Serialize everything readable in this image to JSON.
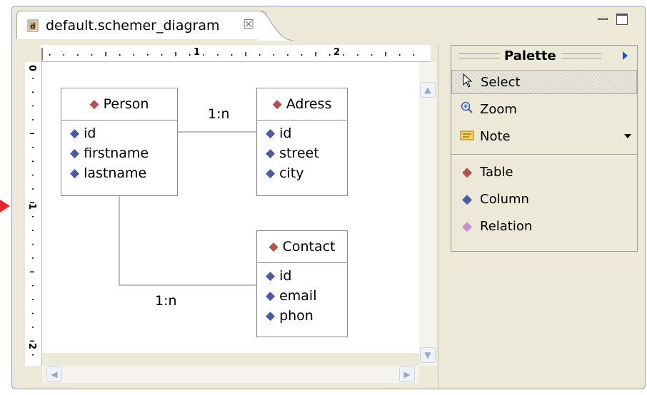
{
  "tab": {
    "title": "default.schemer_diagram",
    "close_glyph": "☒"
  },
  "ruler": {
    "top_labels": [
      "1",
      "2"
    ],
    "left_labels": [
      "0",
      "1",
      "2"
    ]
  },
  "diagram": {
    "tables": [
      {
        "name": "Person",
        "columns": [
          "id",
          "firstname",
          "lastname"
        ]
      },
      {
        "name": "Adress",
        "columns": [
          "id",
          "street",
          "city"
        ]
      },
      {
        "name": "Contact",
        "columns": [
          "id",
          "email",
          "phon"
        ]
      }
    ],
    "relations": [
      {
        "from": "Person",
        "to": "Adress",
        "label": "1:n"
      },
      {
        "from": "Person",
        "to": "Contact",
        "label": "1:n"
      }
    ]
  },
  "palette": {
    "title": "Palette",
    "tools": [
      {
        "label": "Select",
        "icon": "cursor-icon"
      },
      {
        "label": "Zoom",
        "icon": "zoom-icon"
      },
      {
        "label": "Note",
        "icon": "note-icon"
      }
    ],
    "entries": [
      {
        "label": "Table",
        "icon": "table-diamond-icon",
        "color": "#b5514d"
      },
      {
        "label": "Column",
        "icon": "column-diamond-icon",
        "color": "#4a5aa6"
      },
      {
        "label": "Relation",
        "icon": "relation-diamond-icon",
        "color": "#c78fd0"
      }
    ]
  },
  "colors": {
    "accent_arrow": "#e6252a",
    "table_icon": "#b5514d",
    "column_icon": "#4a5aa6",
    "relation_icon": "#c78fd0"
  }
}
